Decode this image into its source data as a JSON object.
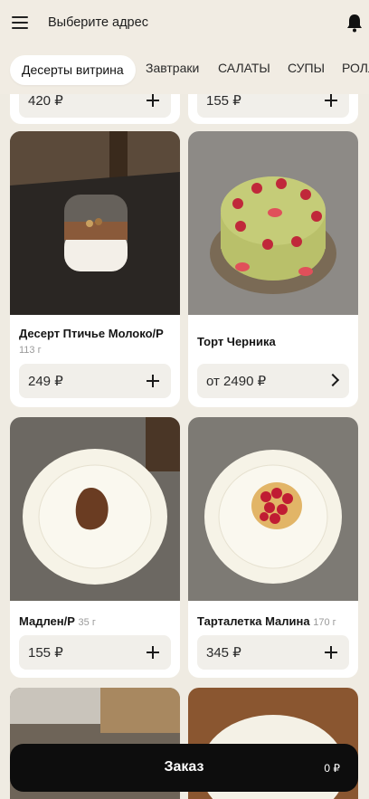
{
  "header": {
    "address_label": "Выберите адрес"
  },
  "tabs": [
    {
      "label": "Десерты витрина",
      "active": true
    },
    {
      "label": "Завтраки"
    },
    {
      "label": "САЛАТЫ"
    },
    {
      "label": "СУПЫ"
    },
    {
      "label": "РОЛЛ"
    }
  ],
  "top_row": [
    {
      "price": "420 ₽"
    },
    {
      "price": "155 ₽"
    }
  ],
  "products": [
    {
      "name": "Десерт Птичье Молоко/Р",
      "weight": "113 г",
      "price": "249 ₽",
      "action": "plus"
    },
    {
      "name": "Торт Черника",
      "weight": "",
      "price": "от 2490 ₽",
      "action": "chevron"
    },
    {
      "name": "Мадлен/Р",
      "weight": "35 г",
      "price": "155 ₽",
      "action": "plus"
    },
    {
      "name": "Тарталетка Малина",
      "weight": "170 г",
      "price": "345 ₽",
      "action": "plus"
    }
  ],
  "order": {
    "label": "Заказ",
    "total": "0 ₽"
  },
  "colors": {
    "background": "#efebe2",
    "card": "#ffffff",
    "order_bar": "#0d0d0d"
  }
}
